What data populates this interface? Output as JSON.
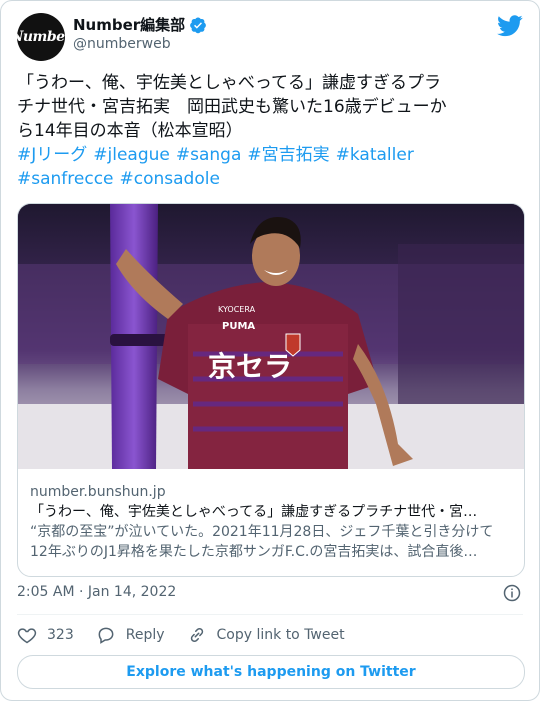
{
  "author": {
    "name": "Number編集部",
    "handle": "@numberweb",
    "avatar_text": "Number"
  },
  "tweet": {
    "lines": [
      "「うわー、俺、宇佐美としゃべってる」謙虚すぎるプラ",
      "チナ世代・宮吉拓実　岡田武史も驚いた16歳デビューか",
      "ら14年目の本音（松本宣昭）"
    ],
    "hashtags_line1": [
      "#Jリーグ",
      "#jleague",
      "#sanga",
      "#宮吉拓実",
      "#kataller"
    ],
    "hashtags_line2": [
      "#sanfrecce",
      "#consadole"
    ]
  },
  "link_card": {
    "domain": "number.bunshun.jp",
    "title": "「うわー、俺、宇佐美としゃべってる」謙虚すぎるプラチナ世代・宮…",
    "description_lines": [
      "“京都の至宝”が泣いていた。2021年11月28日、ジェフ千葉と引き分けて",
      "12年ぶりのJ1昇格を果たした京都サンガF.C.の宮吉拓実は、試合直後…"
    ],
    "photo": {
      "shirt_sponsor": "京セラ",
      "shirt_brand": "PUMA",
      "sleeve_text": "KYOCERA"
    }
  },
  "timestamp": "2:05 AM · Jan 14, 2022",
  "actions": {
    "likes": "323",
    "reply": "Reply",
    "copy_link": "Copy link to Tweet"
  },
  "explore_label": "Explore what's happening on Twitter",
  "colors": {
    "accent": "#1d9bf0",
    "text": "#0f1419",
    "muted": "#536471",
    "border": "#cfd9de"
  },
  "icons": [
    "verified-badge-icon",
    "twitter-bird-icon",
    "info-icon",
    "heart-icon",
    "reply-icon",
    "link-icon"
  ]
}
